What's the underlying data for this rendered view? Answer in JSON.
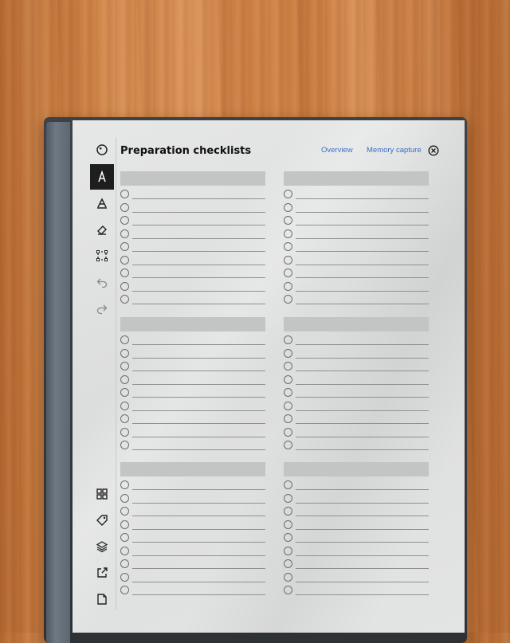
{
  "app": {
    "title": "Preparation checklists"
  },
  "nav": {
    "overview_label": "Overview",
    "memory_label": "Memory capture"
  },
  "toolbar": {
    "top_tools": [
      "menu-circle-icon",
      "pen-icon",
      "marker-icon",
      "eraser-icon",
      "selection-icon",
      "undo-icon",
      "redo-icon"
    ],
    "bottom_tools": [
      "grid-icon",
      "tag-icon",
      "layers-icon",
      "export-icon",
      "page-icon"
    ],
    "active_tool": "pen-icon"
  },
  "checklists": {
    "panel_count": 6,
    "rows_per_panel": 9
  },
  "colors": {
    "link": "#3b6fc4",
    "header_bar": "#c3c4c4",
    "screen": "#e0e1e1"
  }
}
